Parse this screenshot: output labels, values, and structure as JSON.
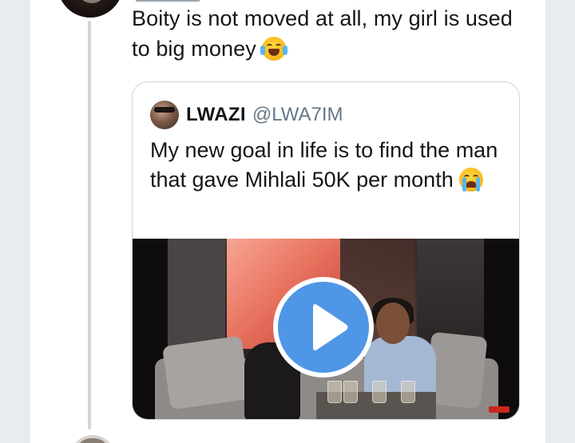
{
  "reply": {
    "text": "Boity is not moved at all, my girl is used to big money",
    "emoji": "face-with-tears-of-joy"
  },
  "quoted_tweet": {
    "name": "LWAZI",
    "handle": "@LWA7IM",
    "text": "My new goal in life is to find the man that gave Mihlali 50K per month",
    "emoji": "loudly-crying-face",
    "media": {
      "type": "video",
      "play_icon": "play-icon",
      "accent": "#4f96e6"
    }
  },
  "colors": {
    "text": "#14171a",
    "secondary": "#657786",
    "border": "#ccd6dd",
    "thread_line": "#ccd6dd",
    "background": "#e6ecf0"
  }
}
